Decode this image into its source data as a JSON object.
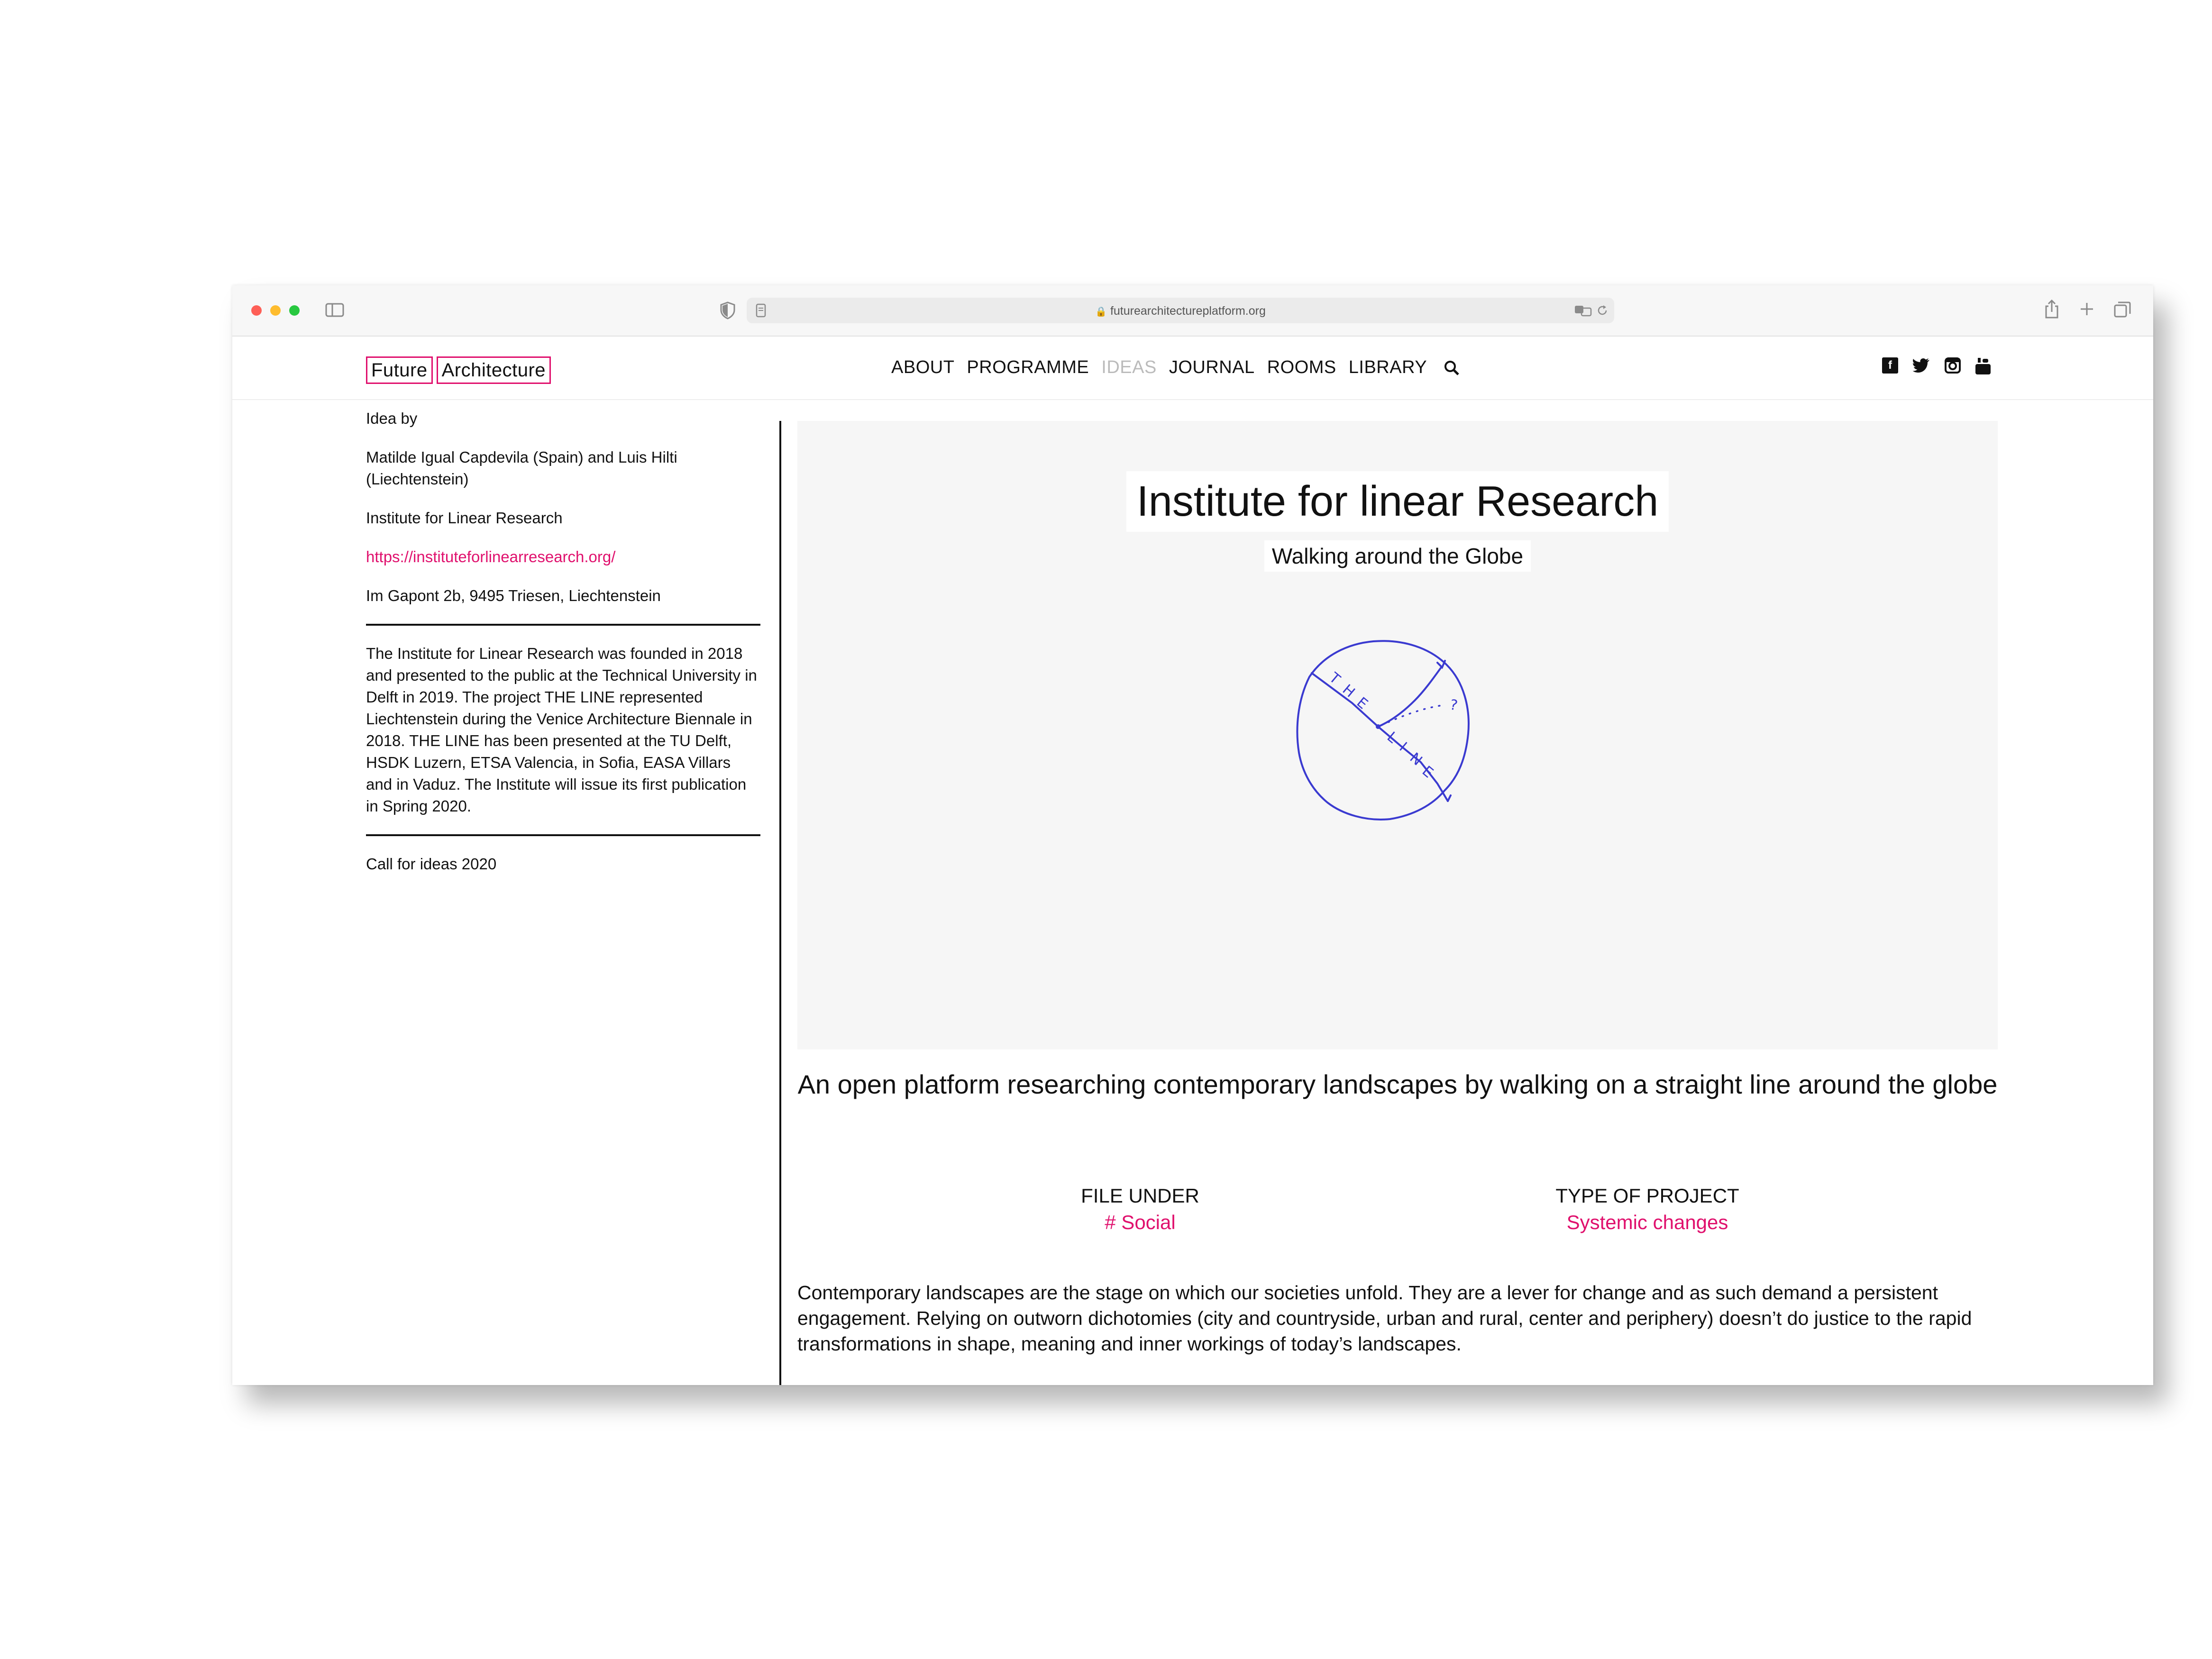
{
  "browser": {
    "url": "futurearchitectureplatform.org"
  },
  "header": {
    "logo": [
      "Future",
      "Architecture"
    ],
    "nav": [
      {
        "label": "ABOUT"
      },
      {
        "label": "PROGRAMME"
      },
      {
        "label": "IDEAS"
      },
      {
        "label": "JOURNAL"
      },
      {
        "label": "ROOMS"
      },
      {
        "label": "LIBRARY"
      }
    ],
    "social": [
      "facebook-icon",
      "twitter-icon",
      "instagram-icon",
      "youtube-icon"
    ]
  },
  "sidebar": {
    "idea_by_label": "Idea by",
    "authors": "Matilde Igual Capdevila (Spain) and Luis Hilti (Liechtenstein)",
    "organisation": "Institute for Linear Research",
    "website": "https://instituteforlinearresearch.org/",
    "address": "Im Gapont 2b, 9495 Triesen, Liechtenstein",
    "description": "The Institute for Linear Research was founded in 2018 and presented to the public at the Technical University in Delft in 2019. The project THE LINE represented Liechtenstein during the Venice Architecture Biennale in 2018. THE LINE has been presented at the TU Delft, HSDK Luzern, ETSA Valencia, in Sofia, EASA Villars and in Vaduz. The Institute will issue its first publication in Spring 2020.",
    "call": "Call for ideas 2020"
  },
  "hero": {
    "title": "Institute for linear Research",
    "subtitle": "Walking around the Globe",
    "graphic_text": "THE LINE",
    "line_color": "#3a3ad0"
  },
  "main": {
    "tagline": "An open platform researching contemporary landscapes by walking on a straight line around the globe",
    "file_under_label": "FILE UNDER",
    "file_under_value": "# Social",
    "type_label": "TYPE OF PROJECT",
    "type_value": "Systemic changes",
    "body": "Contemporary landscapes are the stage on which our societies unfold. They are a lever for change and as such demand a persistent engagement. Relying on outworn dichotomies (city and countryside, urban and rural, center and periphery) doesn’t do justice to the rapid transformations in shape, meaning and inner workings of today’s landscapes."
  },
  "colors": {
    "accent": "#e0106d",
    "muted_nav": "#bbbbbb"
  }
}
